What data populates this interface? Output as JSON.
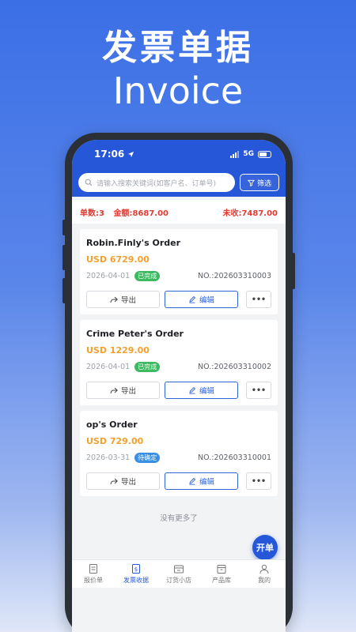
{
  "promo": {
    "title": "发票单据",
    "subtitle": "Invoice"
  },
  "status": {
    "time": "17:06",
    "network": "5G",
    "location_icon": "location-arrow-icon"
  },
  "search": {
    "placeholder": "请输入搜索关键词(如客户名、订单号)",
    "filter_label": "筛选"
  },
  "summary": {
    "count": "单数:3",
    "amount": "金额:8687.00",
    "unpaid": "未收:7487.00"
  },
  "invoices": [
    {
      "title": "Robin.Finly's Order",
      "amount": "USD 6729.00",
      "date": "2026-04-01",
      "status": "已完成",
      "number": "NO.:202603310003"
    },
    {
      "title": "Crime Peter's Order",
      "amount": "USD 1229.00",
      "date": "2026-04-01",
      "status": "已完成",
      "number": "NO.:202603310002"
    },
    {
      "title": "op's Order",
      "amount": "USD 729.00",
      "date": "2026-03-31",
      "status": "待确定",
      "number": "NO.:202603310001"
    }
  ],
  "actions": {
    "export": "导出",
    "edit": "编辑",
    "more": "•••"
  },
  "list_footer": "没有更多了",
  "fab_label": "开单",
  "tabs": [
    {
      "label": "报价单",
      "icon": "quote-icon"
    },
    {
      "label": "发票收据",
      "icon": "invoice-icon"
    },
    {
      "label": "订货小店",
      "icon": "shop-icon"
    },
    {
      "label": "产品库",
      "icon": "product-box-icon"
    },
    {
      "label": "我的",
      "icon": "user-icon"
    }
  ],
  "colors": {
    "brand": "#2657d8",
    "amount": "#f2a12e",
    "done": "#3cb961",
    "pending": "#3a8fe0",
    "alert": "#e03b32"
  }
}
